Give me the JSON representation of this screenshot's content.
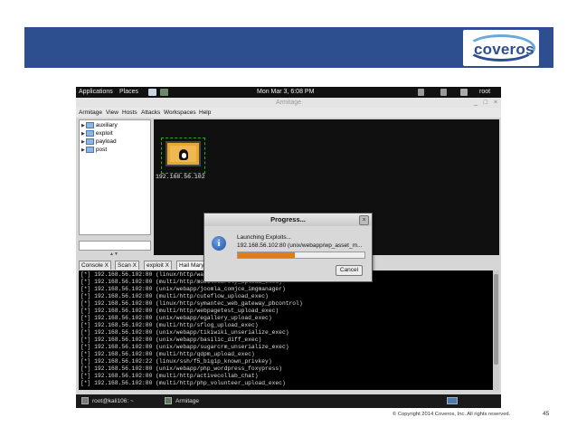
{
  "slide": {
    "logo_text": "coveros",
    "copyright": "© Copyright 2014 Coveros, Inc. All rights reserved.",
    "page_number": "45",
    "colors": {
      "banner": "#2d4f8f",
      "accent": "#6aa9d8"
    }
  },
  "desktop": {
    "topbar": {
      "applications": "Applications",
      "places": "Places",
      "datetime": "Mon Mar 3,  6:08 PM",
      "user": "root"
    },
    "window_title": "Armitage",
    "menu": [
      "Armitage",
      "View",
      "Hosts",
      "Attacks",
      "Workspaces",
      "Help"
    ],
    "tree": [
      {
        "label": "auxiliary",
        "icon": "folder-icon"
      },
      {
        "label": "exploit",
        "icon": "folder-icon"
      },
      {
        "label": "payload",
        "icon": "folder-icon"
      },
      {
        "label": "post",
        "icon": "folder-icon"
      }
    ],
    "host": {
      "ip": "192.168.56.102",
      "icon": "linux-host-icon"
    },
    "tabs": [
      {
        "label": "Console",
        "close": "X"
      },
      {
        "label": "Scan",
        "close": "X"
      },
      {
        "label": "exploit",
        "close": "X"
      },
      {
        "label": "Hail Mary",
        "close": "X"
      }
    ],
    "console_lines": [
      "[*] 192.168.56.102:80 (linux/http/wanem_exec)",
      "[*] 192.168.56.102:80 (multi/http/mobilecartly_upload_exec)",
      "[*] 192.168.56.102:80 (unix/webapp/joomla_comjce_imgmanager)",
      "[*] 192.168.56.102:80 (multi/http/cuteflow_upload_exec)",
      "[*] 192.168.56.102:80 (linux/http/symantec_web_gateway_pbcontrol)",
      "[*] 192.168.56.102:80 (multi/http/webpagetest_upload_exec)",
      "[*] 192.168.56.102:80 (unix/webapp/egallery_upload_exec)",
      "[*] 192.168.56.102:80 (multi/http/sflog_upload_exec)",
      "[*] 192.168.56.102:80 (unix/webapp/tikiwiki_unserialize_exec)",
      "[*] 192.168.56.102:80 (unix/webapp/basilic_diff_exec)",
      "[*] 192.168.56.102:80 (unix/webapp/sugarcrm_unserialize_exec)",
      "[*] 192.168.56.102:80 (multi/http/qdpm_upload_exec)",
      "[*] 192.168.56.102:22 (linux/ssh/f5_bigip_known_privkey)",
      "[*] 192.168.56.102:80 (unix/webapp/php_wordpress_foxypress)",
      "[*] 192.168.56.102:80 (multi/http/activecollab_chat)",
      "[*] 192.168.56.102:80 (multi/http/php_volunteer_upload_exec)"
    ],
    "taskbar": {
      "terminal": "root@kali106: ~",
      "armitage": "Armitage"
    },
    "dialog": {
      "title": "Progress...",
      "close": "×",
      "message1": "Launching Exploits...",
      "message2": "192.168.56.102:80 (unix/webapp/wp_asset_m...",
      "progress": 0.45,
      "cancel_label": "Cancel"
    }
  }
}
